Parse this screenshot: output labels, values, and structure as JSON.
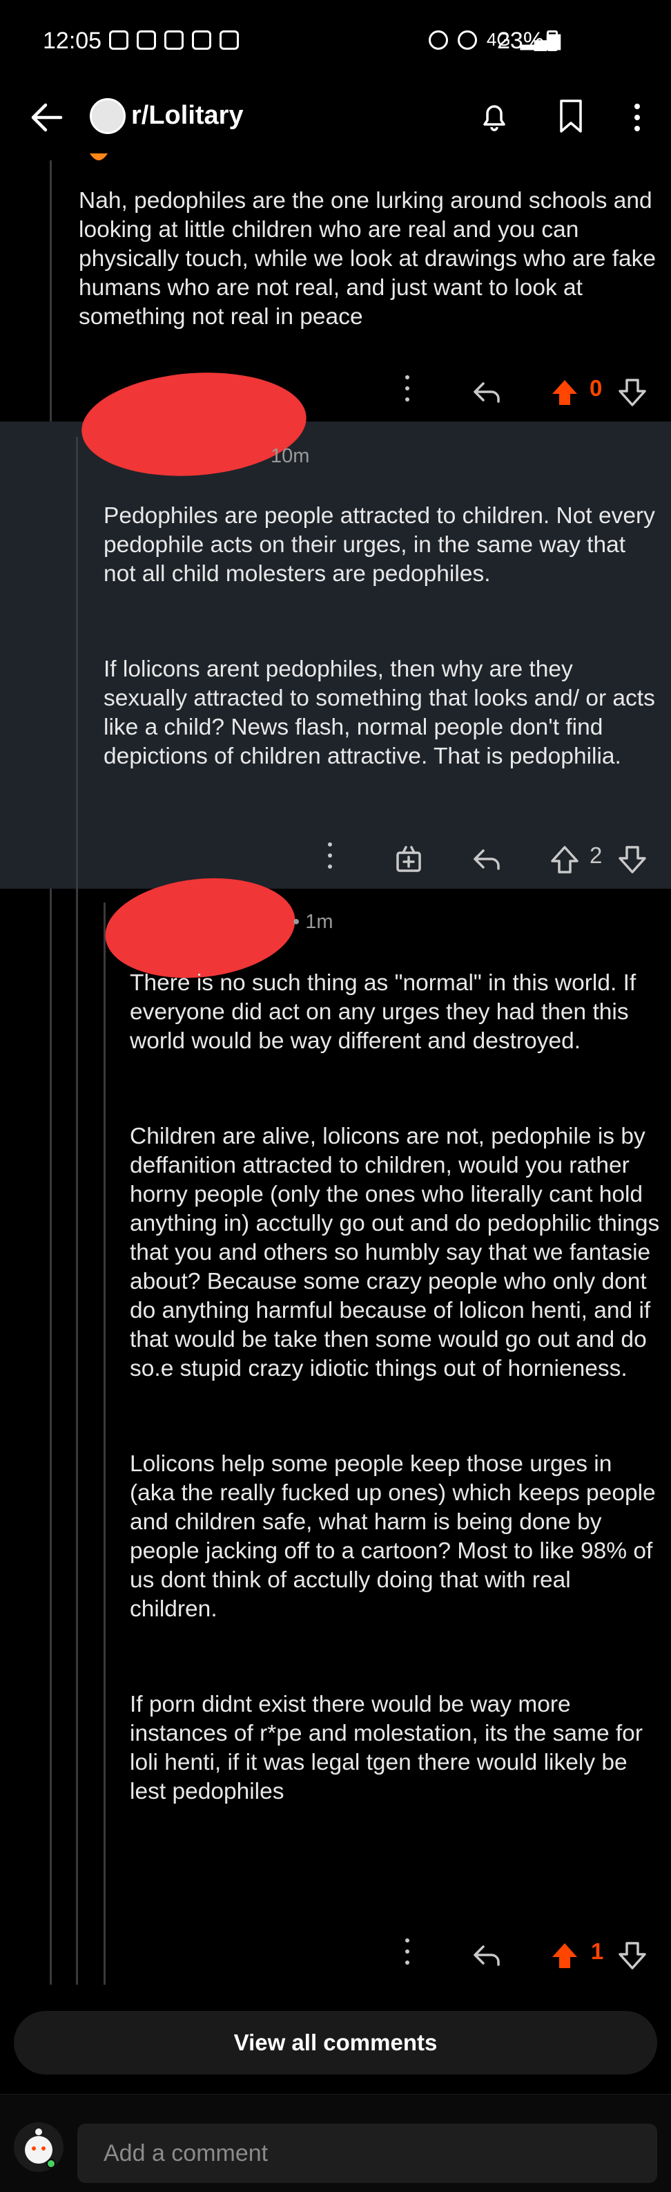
{
  "status_bar": {
    "time": "12:05",
    "network": "4G",
    "battery": "23%"
  },
  "header": {
    "subreddit": "r/Lolitary"
  },
  "comments": [
    {
      "paragraphs": [
        "Nah, pedophiles are the one lurking around schools and looking at little children who are real and you can physically touch, while we look at drawings who are fake humans who are not real, and just want to look at something not real in peace"
      ],
      "score": "0"
    },
    {
      "time": "10m",
      "paragraphs": [
        "Pedophiles are people attracted to children. Not every pedophile acts on their urges, in the same way that not all child molesters are pedophiles.",
        "If lolicons arent pedophiles, then why are they sexually attracted to something that looks and/ or acts like a child? News flash, normal people don't find depictions of children attractive. That is pedophilia."
      ],
      "score": "2"
    },
    {
      "time": "• 1m",
      "paragraphs": [
        "There is no such thing as \"normal\" in this world. If everyone did act on any urges they had then this world would be way different and destroyed.",
        "Children are alive, lolicons are not, pedophile is by deffanition attracted to children, would you rather horny people (only the ones who literally cant hold anything in) acctully go out and do pedophilic things that you and others so humbly say that we fantasie about? Because some crazy people who only dont do anything harmful because of lolicon henti, and if that would be take then some would go out and do so.e stupid crazy idiotic things out of hornieness.",
        "Lolicons help some people keep those urges in (aka the really fucked up ones) which keeps people and children safe, what harm is being done by people jacking off to a cartoon? Most to like 98% of us dont think of acctully doing that with real children.",
        "If porn didnt exist there would be way more instances of r*pe and molestation, its the same for loli henti, if it was legal tgen there would likely be lest pedophiles"
      ],
      "score": "1"
    }
  ],
  "footer": {
    "view_all": "View all comments",
    "comment_placeholder": "Add a comment"
  },
  "colors": {
    "upvote_active": "#ff4500",
    "highlight_bg": "#1f242a",
    "redaction": "#f03636"
  }
}
